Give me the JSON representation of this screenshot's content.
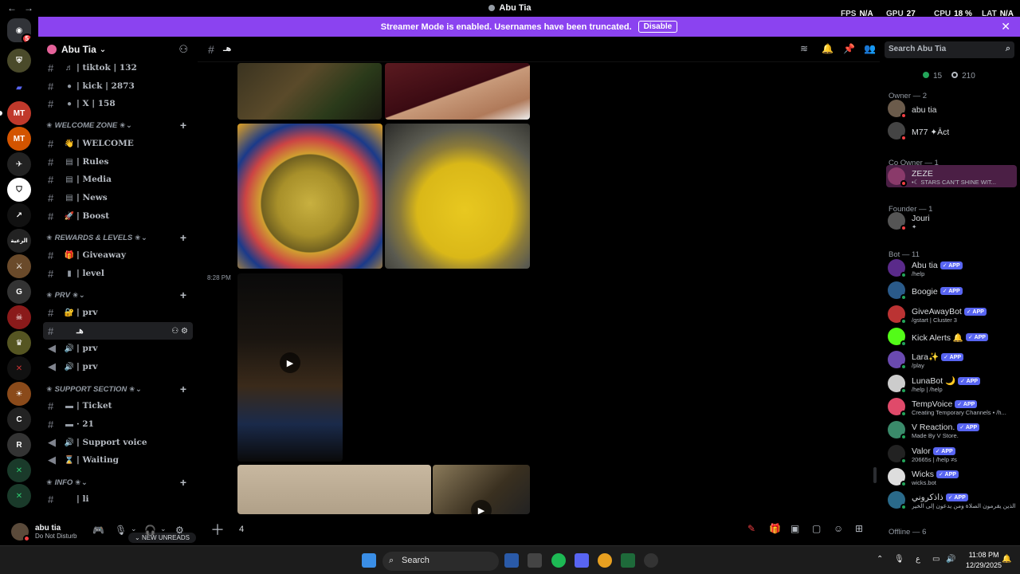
{
  "window": {
    "title": "Abu Tia",
    "back": "←",
    "forward": "→"
  },
  "overlay": {
    "fps_label": "FPS",
    "fps_value": "N/A",
    "gpu_label": "GPU",
    "gpu_value": "27",
    "cpu_label": "CPU",
    "cpu_value": "18 %",
    "lat_label": "LAT",
    "lat_value": "N/A"
  },
  "banner": {
    "text": "Streamer Mode is enabled. Usernames have been truncated.",
    "disable": "Disable",
    "close": "✕"
  },
  "rail": {
    "badge": "5"
  },
  "guild": {
    "name": "Abu Tia",
    "chevron": "⌄"
  },
  "channels": [
    {
      "type": "text",
      "emoji": "♬",
      "name": "| tiktok | 132"
    },
    {
      "type": "text",
      "emoji": "●",
      "name": "| kick | 2873"
    },
    {
      "type": "text",
      "emoji": "●",
      "name": "| X | 158"
    },
    {
      "type": "category",
      "name": "✬ WELCOME ZONE ✬"
    },
    {
      "type": "text",
      "emoji": "👋",
      "name": "| WELCOME"
    },
    {
      "type": "text",
      "emoji": "▤",
      "name": "| Rules"
    },
    {
      "type": "text",
      "emoji": "▤",
      "name": "| Media"
    },
    {
      "type": "text",
      "emoji": "▤",
      "name": "| News"
    },
    {
      "type": "text",
      "emoji": "🚀",
      "name": "| Boost"
    },
    {
      "type": "category",
      "name": "✬ REWARDS & LEVELS ✬"
    },
    {
      "type": "text",
      "emoji": "🎁",
      "name": "| Giveaway"
    },
    {
      "type": "text",
      "emoji": "▮",
      "name": "| level"
    },
    {
      "type": "category",
      "name": "✬ PRV ✬"
    },
    {
      "type": "text",
      "emoji": "🔐",
      "name": "| prv"
    },
    {
      "type": "text-active",
      "emoji": "",
      "name": "هـ"
    },
    {
      "type": "voice",
      "emoji": "🔊",
      "name": "| prv"
    },
    {
      "type": "voice",
      "emoji": "🔊",
      "name": "| prv"
    },
    {
      "type": "category",
      "name": "✬ SUPPORT SECTION ✬"
    },
    {
      "type": "text",
      "emoji": "▬",
      "name": "| Ticket"
    },
    {
      "type": "text",
      "emoji": "▬",
      "name": "· 21"
    },
    {
      "type": "voice",
      "emoji": "🔊",
      "name": "| Support voice"
    },
    {
      "type": "voice",
      "emoji": "⌛",
      "name": "| Waiting"
    },
    {
      "type": "category",
      "name": "✬ INFO ✬"
    },
    {
      "type": "text",
      "emoji": "",
      "name": "| li"
    }
  ],
  "new_unreads": "NEW UNREADS",
  "user": {
    "name": "abu tia",
    "status": "Do Not Disturb"
  },
  "main": {
    "channel_name": "هـ",
    "timestamp": "8:28 PM",
    "composer_text": "4"
  },
  "search": {
    "placeholder": "Search Abu Tia"
  },
  "members": {
    "online": "15",
    "total": "210",
    "groups": [
      {
        "title": "Owner — 2"
      },
      {
        "title": "Co Owner — 1"
      },
      {
        "title": "Founder — 1"
      },
      {
        "title": "Bot — 11"
      },
      {
        "title": "Offline — 6"
      }
    ],
    "list": [
      {
        "name": "abu tia",
        "sub": "",
        "app": false,
        "color": "#6b5b4b",
        "status": "#f23f42"
      },
      {
        "name": "M77 ✦Āct",
        "sub": "",
        "app": false,
        "color": "#444",
        "status": "#f23f42"
      },
      {
        "name": "ZEZE",
        "sub": "•☾ STARS CAN'T SHINE WIT...",
        "app": false,
        "color": "#8a3a6a",
        "status": "#f23f42"
      },
      {
        "name": "Jouri",
        "sub": "✦",
        "app": false,
        "color": "#555",
        "status": "#f23f42"
      },
      {
        "name": "Abu tia",
        "sub": "/help",
        "app": true,
        "app_label": "✓ APP",
        "color": "#5a2a8a",
        "status": "#23a55a"
      },
      {
        "name": "Boogie",
        "sub": "",
        "app": true,
        "app_label": "✓ APP",
        "color": "#2a5a8a",
        "status": "#23a55a"
      },
      {
        "name": "GiveAwayBot",
        "sub": "/gstart | Cluster 3",
        "app": true,
        "app_label": "✓ APP",
        "color": "#b33",
        "status": "#23a55a"
      },
      {
        "name": "Kick Alerts 🔔",
        "sub": "",
        "app": true,
        "app_label": "✓ APP",
        "color": "#53fc18",
        "status": "#23a55a"
      },
      {
        "name": "Lara✨",
        "sub": "/play",
        "app": true,
        "app_label": "✓ APP",
        "color": "#6a4ab0",
        "status": "#23a55a"
      },
      {
        "name": "LunaBot 🌙",
        "sub": "/help | /help",
        "app": true,
        "app_label": "✓ APP",
        "color": "#ccc",
        "status": "#23a55a"
      },
      {
        "name": "TempVoice",
        "sub": "Creating Temporary Channels • /h...",
        "app": true,
        "app_label": "✓ APP",
        "color": "#e04a6a",
        "status": "#23a55a"
      },
      {
        "name": "V Reaction.",
        "sub": "Made By V Store.",
        "app": true,
        "app_label": "✓ APP",
        "color": "#3a8a6a",
        "status": "#23a55a"
      },
      {
        "name": "Valor",
        "sub": "20665s | /help ≠s",
        "app": true,
        "app_label": "✓ APP",
        "color": "#222",
        "status": "#23a55a"
      },
      {
        "name": "Wicks",
        "sub": "wicks.bot",
        "app": true,
        "app_label": "✓ APP",
        "color": "#ddd",
        "status": "#23a55a"
      },
      {
        "name": "ذاذكروني",
        "sub": "شخص الذين يقرمون الصلاة ومن يدعون إلى الخير",
        "app": true,
        "app_label": "✓ APP",
        "color": "#2a6a8a",
        "status": "#23a55a"
      }
    ]
  },
  "taskbar": {
    "search": "Search",
    "time": "11:08 PM",
    "date": "12/29/2025",
    "lang": "ع"
  },
  "colors": {
    "accent": "#5865f2",
    "banner": "#8b43f0",
    "dnd": "#f23f42",
    "online": "#23a55a"
  }
}
